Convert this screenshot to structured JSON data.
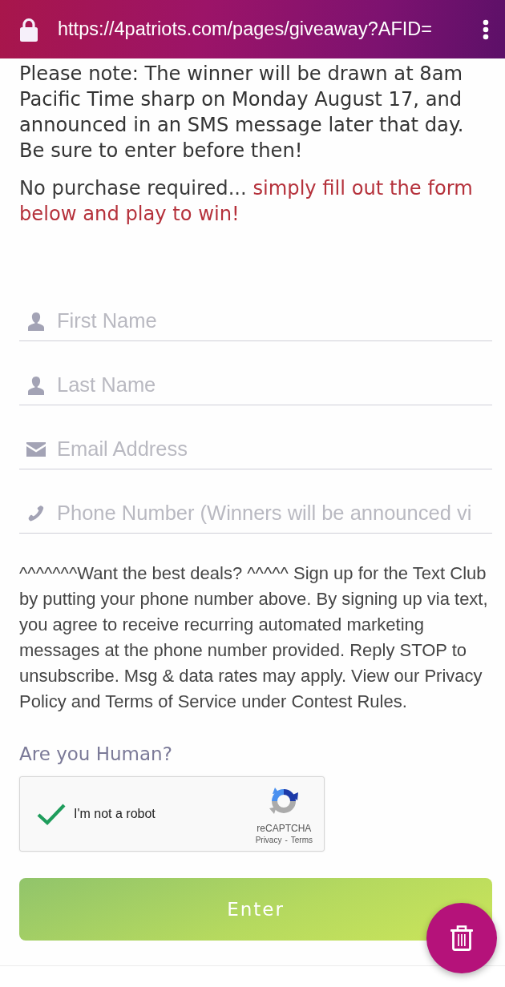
{
  "address_bar": {
    "url": "https://4patriots.com/pages/giveaway?AFID="
  },
  "notice": "Please note: The winner will be drawn at 8am Pacific Time sharp on Monday August 17, and announced in an SMS message later that day. Be sure to enter before then!",
  "intro": {
    "lead": "No purchase required...",
    "emphasis": "simply fill out the form below and play to win!"
  },
  "fields": [
    {
      "kind": "person",
      "placeholder": "First Name"
    },
    {
      "kind": "person",
      "placeholder": "Last Name"
    },
    {
      "kind": "email",
      "placeholder": "Email Address"
    },
    {
      "kind": "phone",
      "placeholder": "Phone Number (Winners will be announced vi"
    }
  ],
  "disclaimer": "^^^^^^^Want the best deals? ^^^^^ Sign up for the Text Club by putting your phone number above. By signing up via text, you agree to receive recurring automated marketing messages at the phone number provided. Reply STOP to unsubscribe. Msg & data rates may apply. View our Privacy Policy and Terms of Service under Contest Rules.",
  "captcha": {
    "heading": "Are you Human?",
    "label": "I'm not a robot",
    "checked": true,
    "brand": "reCAPTCHA",
    "privacy_link": "Privacy",
    "separator": "-",
    "terms_link": "Terms"
  },
  "submit": {
    "label": "Enter"
  }
}
